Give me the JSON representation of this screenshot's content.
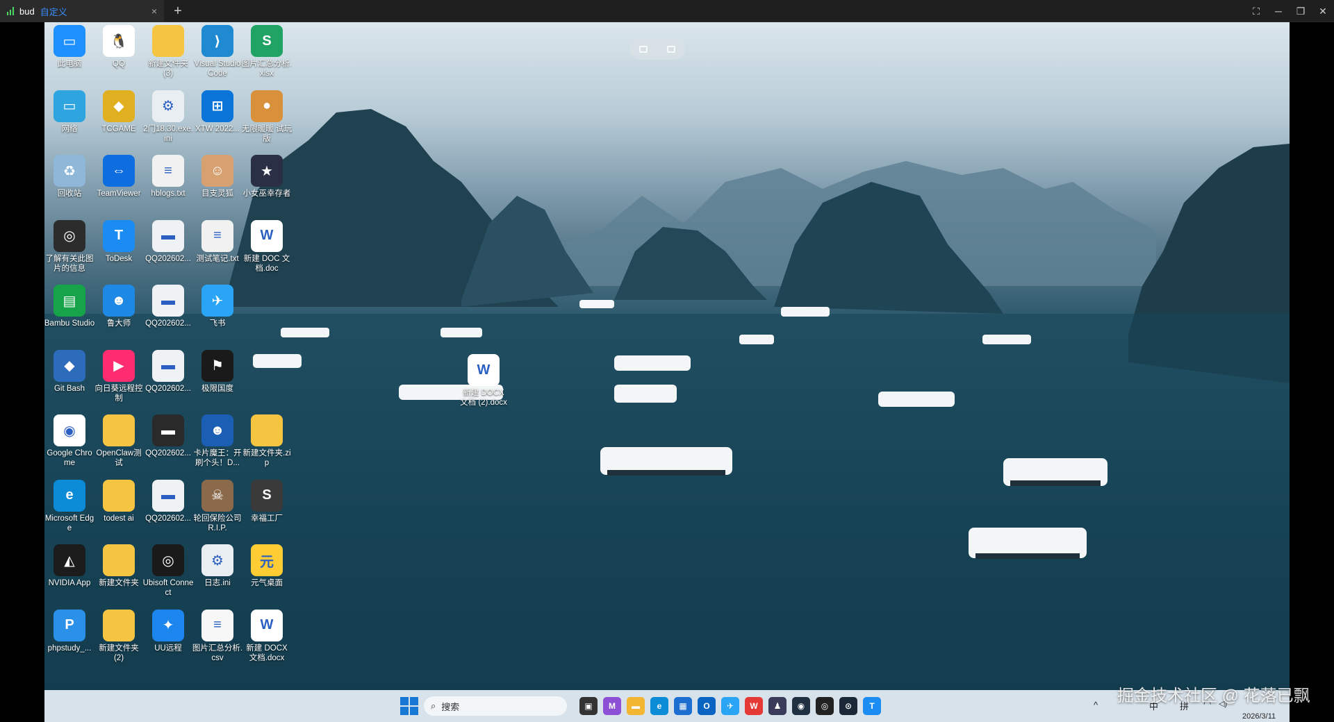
{
  "client": {
    "tab_name": "bud",
    "tab_extra": "自定义",
    "close_glyph": "×",
    "newtab_glyph": "+",
    "ctrl_fullscreen": "⛶",
    "ctrl_minimize": "─",
    "ctrl_restore": "❐",
    "ctrl_close": "✕"
  },
  "desktop_icons": [
    {
      "label": "此电脑",
      "icon": "computer-icon",
      "color": "#1e90ff",
      "glyph": "▭"
    },
    {
      "label": "QQ",
      "icon": "qq-icon",
      "color": "#ffffff",
      "glyph": "🐧"
    },
    {
      "label": "新建文件夹 (3)",
      "icon": "folder-icon",
      "color": "#f5c542",
      "glyph": ""
    },
    {
      "label": "Visual Studio Code",
      "icon": "vscode-icon",
      "color": "#1f8ad2",
      "glyph": "⟩"
    },
    {
      "label": "图片汇总分析.xlsx",
      "icon": "xlsx-icon",
      "color": "#21a366",
      "glyph": "S"
    },
    {
      "label": "网络",
      "icon": "network-icon",
      "color": "#2fa5e0",
      "glyph": "▭"
    },
    {
      "label": "TCGAME",
      "icon": "tcgame-icon",
      "color": "#e0b020",
      "glyph": "◆"
    },
    {
      "label": "2门18.30.exe.ini",
      "icon": "ini-file-icon",
      "color": "#e9eef2",
      "glyph": "⚙"
    },
    {
      "label": "XTW 2022...",
      "icon": "windows-icon",
      "color": "#0a74d8",
      "glyph": "⊞"
    },
    {
      "label": "无限暖暖 试玩版",
      "icon": "game-demo-icon",
      "color": "#d9903a",
      "glyph": "●"
    },
    {
      "label": "回收站",
      "icon": "recycle-bin-icon",
      "color": "#8fb8d8",
      "glyph": "♻"
    },
    {
      "label": "TeamViewer",
      "icon": "teamviewer-icon",
      "color": "#0e6ee0",
      "glyph": "⇔"
    },
    {
      "label": "hblogs.txt",
      "icon": "txt-file-icon",
      "color": "#f1f1f1",
      "glyph": "≡"
    },
    {
      "label": "目支灵狐",
      "icon": "anime-app-icon",
      "color": "#d7a070",
      "glyph": "☺"
    },
    {
      "label": "小女巫幸存者",
      "icon": "star-game-icon",
      "color": "#2a2f45",
      "glyph": "★"
    },
    {
      "label": "了解有关此图片的信息",
      "icon": "camera-info-icon",
      "color": "#2c2c2c",
      "glyph": "◎"
    },
    {
      "label": "ToDesk",
      "icon": "todesk-icon",
      "color": "#1b8cf2",
      "glyph": "T"
    },
    {
      "label": "QQ202602...",
      "icon": "image-file-icon",
      "color": "#eef2f5",
      "glyph": "▬"
    },
    {
      "label": "测试笔记.txt",
      "icon": "txt-file-icon",
      "color": "#f1f1f1",
      "glyph": "≡"
    },
    {
      "label": "新建 DOC 文档.doc",
      "icon": "word-doc-icon",
      "color": "#ffffff",
      "glyph": "W"
    },
    {
      "label": "Bambu Studio",
      "icon": "bambu-icon",
      "color": "#16a34a",
      "glyph": "▤"
    },
    {
      "label": "鲁大师",
      "icon": "ludashi-icon",
      "color": "#1e88e5",
      "glyph": "☻"
    },
    {
      "label": "QQ202602...",
      "icon": "image-file-icon",
      "color": "#eef2f5",
      "glyph": "▬"
    },
    {
      "label": "飞书",
      "icon": "feishu-icon",
      "color": "#2aa4f4",
      "glyph": "✈"
    },
    {
      "label": "",
      "icon": "empty-slot",
      "color": "transparent",
      "glyph": ""
    },
    {
      "label": "Git Bash",
      "icon": "git-icon",
      "color": "#2d6bbb",
      "glyph": "◆"
    },
    {
      "label": "向日葵远程控制",
      "icon": "sunlogin-icon",
      "color": "#ff2d6f",
      "glyph": "▶"
    },
    {
      "label": "QQ202602...",
      "icon": "image-file-icon",
      "color": "#eef2f5",
      "glyph": "▬"
    },
    {
      "label": "极限国度",
      "icon": "forza-icon",
      "color": "#1a1a1a",
      "glyph": "⚑"
    },
    {
      "label": "",
      "icon": "empty-slot",
      "color": "transparent",
      "glyph": ""
    },
    {
      "label": "Google Chrome",
      "icon": "chrome-icon",
      "color": "#ffffff",
      "glyph": "◉"
    },
    {
      "label": "OpenClaw测试",
      "icon": "folder-icon",
      "color": "#f5c542",
      "glyph": ""
    },
    {
      "label": "QQ202602...",
      "icon": "image-file-icon",
      "color": "#2a2a2a",
      "glyph": "▬"
    },
    {
      "label": "卡片魔王：开刷个头！D...",
      "icon": "card-game-icon",
      "color": "#1a5fb4",
      "glyph": "☻"
    },
    {
      "label": "新建文件夹.zip",
      "icon": "zip-folder-icon",
      "color": "#f5c542",
      "glyph": ""
    },
    {
      "label": "Microsoft Edge",
      "icon": "edge-icon",
      "color": "#0c8bd6",
      "glyph": "e"
    },
    {
      "label": "todest ai",
      "icon": "folder-icon",
      "color": "#f5c542",
      "glyph": ""
    },
    {
      "label": "QQ202602...",
      "icon": "image-file-icon",
      "color": "#eef2f5",
      "glyph": "▬"
    },
    {
      "label": "轮回保险公司 R.I.P.",
      "icon": "rip-game-icon",
      "color": "#8a6a4a",
      "glyph": "☠"
    },
    {
      "label": "幸福工厂",
      "icon": "satisfactory-icon",
      "color": "#3a3a3a",
      "glyph": "S"
    },
    {
      "label": "NVIDIA App",
      "icon": "nvidia-icon",
      "color": "#1c1c1c",
      "glyph": "◭"
    },
    {
      "label": "新建文件夹",
      "icon": "folder-icon",
      "color": "#f5c542",
      "glyph": ""
    },
    {
      "label": "Ubisoft Connect",
      "icon": "ubisoft-icon",
      "color": "#1a1a1a",
      "glyph": "◎"
    },
    {
      "label": "日志.ini",
      "icon": "ini-file-icon",
      "color": "#e9eef2",
      "glyph": "⚙"
    },
    {
      "label": "元气桌面",
      "icon": "yuanqi-icon",
      "color": "#ffcc33",
      "glyph": "元"
    },
    {
      "label": "phpstudy_...",
      "icon": "phpstudy-icon",
      "color": "#2b90e8",
      "glyph": "P"
    },
    {
      "label": "新建文件夹 (2)",
      "icon": "folder-icon",
      "color": "#f5c542",
      "glyph": ""
    },
    {
      "label": "UU远程",
      "icon": "uu-remote-icon",
      "color": "#1c86ee",
      "glyph": "✦"
    },
    {
      "label": "图片汇总分析.csv",
      "icon": "csv-file-icon",
      "color": "#f7f7f7",
      "glyph": "≡"
    },
    {
      "label": "新建 DOCX 文档.docx",
      "icon": "word-docx-icon",
      "color": "#ffffff",
      "glyph": "W"
    }
  ],
  "dragged_icon": {
    "label": "新建 DOCX 文档 (2).docx",
    "icon": "word-docx-icon",
    "glyph": "W"
  },
  "taskbar": {
    "search_placeholder": "搜索",
    "apps": [
      {
        "name": "task-view-icon",
        "color": "#333333",
        "glyph": "▣"
      },
      {
        "name": "m365-icon",
        "color": "#8c4fd6",
        "glyph": "M"
      },
      {
        "name": "file-explorer-icon",
        "color": "#f2b632",
        "glyph": "▬"
      },
      {
        "name": "edge-icon",
        "color": "#0c8bd6",
        "glyph": "e"
      },
      {
        "name": "store-icon",
        "color": "#1c6fd1",
        "glyph": "▦"
      },
      {
        "name": "outlook-icon",
        "color": "#0a64c2",
        "glyph": "O"
      },
      {
        "name": "feishu-icon",
        "color": "#2aa4f4",
        "glyph": "✈"
      },
      {
        "name": "wps-icon",
        "color": "#e53935",
        "glyph": "W"
      },
      {
        "name": "cat-app-icon",
        "color": "#3a3a5a",
        "glyph": "♟"
      },
      {
        "name": "camera-icon",
        "color": "#203040",
        "glyph": "◉"
      },
      {
        "name": "ubisoft-icon",
        "color": "#222222",
        "glyph": "◎"
      },
      {
        "name": "steam-icon",
        "color": "#1b2838",
        "glyph": "⊙"
      },
      {
        "name": "todesk-icon",
        "color": "#1b8cf2",
        "glyph": "T"
      }
    ],
    "tray": {
      "chevron": "^",
      "ime_zh": "中",
      "ime_pinyin": "拼",
      "wifi": "◠",
      "volume": "◁)"
    },
    "date": "2026/3/11"
  },
  "watermark": "掘金技术社区 @ 花落已飘"
}
